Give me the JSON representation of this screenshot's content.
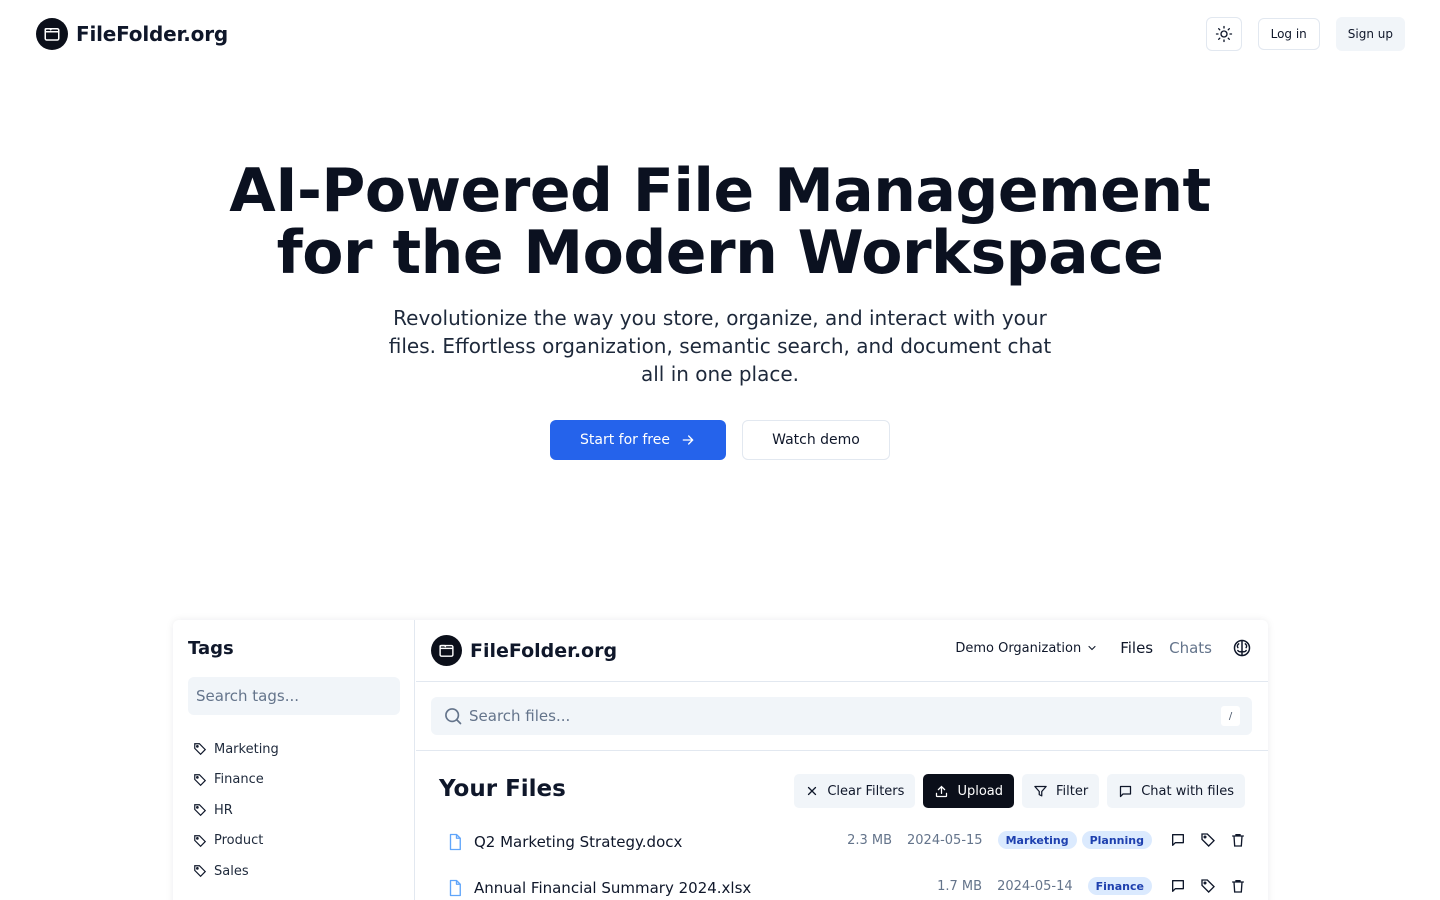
{
  "nav": {
    "brand": "FileFolder.org",
    "login": "Log in",
    "signup": "Sign up"
  },
  "hero": {
    "title_line1": "AI-Powered File Management",
    "title_line2": "for the Modern Workspace",
    "subtitle": "Revolutionize the way you store, organize, and interact with your files. Effortless organization, semantic search, and document chat all in one place.",
    "cta_primary": "Start for free",
    "cta_secondary": "Watch demo"
  },
  "app": {
    "brand": "FileFolder.org",
    "org": "Demo Organization",
    "nav_files": "Files",
    "nav_chats": "Chats",
    "search_placeholder": "Search files...",
    "search_shortcut": "/",
    "sidebar": {
      "title": "Tags",
      "search_placeholder": "Search tags...",
      "tags": [
        "Marketing",
        "Finance",
        "HR",
        "Product",
        "Sales"
      ]
    },
    "files_title": "Your Files",
    "toolbar": {
      "clear": "Clear Filters",
      "upload": "Upload",
      "filter": "Filter",
      "chat": "Chat with files"
    },
    "files": [
      {
        "name": "Q2 Marketing Strategy.docx",
        "size": "2.3 MB",
        "date": "2024-05-15",
        "tags": [
          "Marketing",
          "Planning"
        ]
      },
      {
        "name": "Annual Financial Summary 2024.xlsx",
        "size": "1.7 MB",
        "date": "2024-05-14",
        "tags": [
          "Finance"
        ]
      }
    ]
  },
  "colors": {
    "primary": "#2563eb",
    "dark": "#0b0f1a",
    "badge_bg": "#dbeafe",
    "badge_text": "#1e40af"
  }
}
